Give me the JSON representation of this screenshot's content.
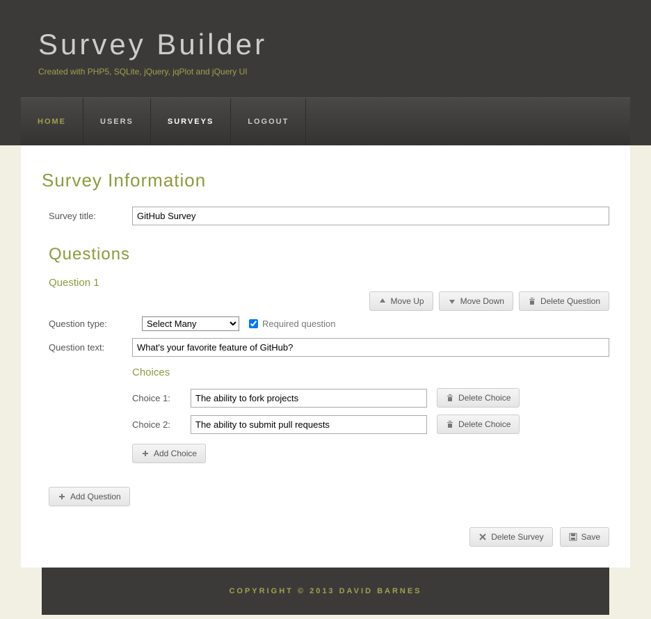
{
  "header": {
    "title": "Survey Builder",
    "tagline": "Created with PHP5, SQLite, jQuery, jqPlot and jQuery UI"
  },
  "nav": {
    "home": "HOME",
    "users": "USERS",
    "surveys": "SURVEYS",
    "logout": "LOGOUT"
  },
  "sections": {
    "surveyInfo": "Survey Information",
    "questions": "Questions",
    "choices": "Choices"
  },
  "labels": {
    "surveyTitle": "Survey title:",
    "questionType": "Question type:",
    "questionText": "Question text:",
    "requiredQuestion": "Required question",
    "choice1": "Choice 1:",
    "choice2": "Choice 2:"
  },
  "values": {
    "surveyTitle": "GitHub Survey",
    "questionType": "Select Many",
    "questionText": "What's your favorite feature of GitHub?",
    "requiredChecked": true,
    "choice1": "The ability to fork projects",
    "choice2": "The ability to submit pull requests"
  },
  "question1": {
    "heading": "Question 1"
  },
  "buttons": {
    "moveUp": "Move Up",
    "moveDown": "Move Down",
    "deleteQuestion": "Delete Question",
    "deleteChoice": "Delete Choice",
    "addChoice": "Add Choice",
    "addQuestion": "Add Question",
    "deleteSurvey": "Delete Survey",
    "save": "Save"
  },
  "footer": {
    "text": "COPYRIGHT © 2013 DAVID BARNES"
  }
}
